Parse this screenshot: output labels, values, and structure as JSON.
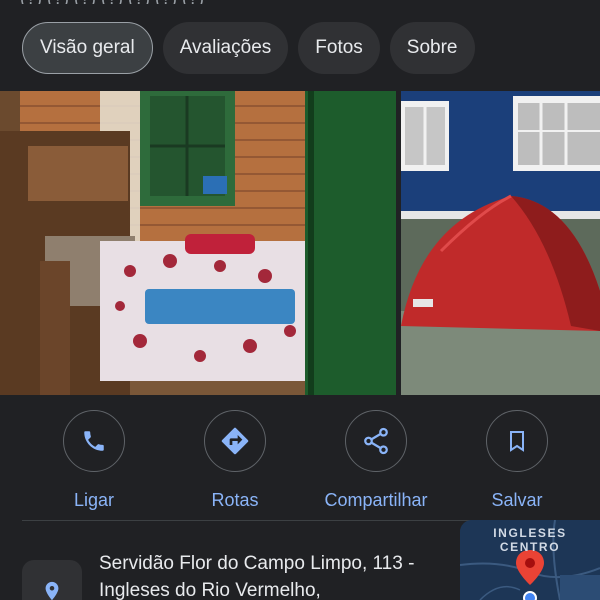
{
  "header": {
    "clipped_text": "(?) (?) (?) (?) (?) (?) (?)"
  },
  "tabs": [
    {
      "label": "Visão geral",
      "active": true
    },
    {
      "label": "Avaliações",
      "active": false
    },
    {
      "label": "Fotos",
      "active": false
    },
    {
      "label": "Sobre",
      "active": false
    }
  ],
  "photos": [
    {
      "icon": "bedroom-photo"
    },
    {
      "icon": "tent-photo"
    }
  ],
  "actions": [
    {
      "label": "Ligar",
      "icon": "phone-icon"
    },
    {
      "label": "Rotas",
      "icon": "directions-icon"
    },
    {
      "label": "Compartilhar",
      "icon": "share-icon"
    },
    {
      "label": "Salvar",
      "icon": "bookmark-icon"
    }
  ],
  "address": {
    "line1": "Servidão Flor do Campo Limpo, 113 -",
    "line2": "Ingleses do Rio Vermelho,",
    "icon": "location-pin-icon"
  },
  "map": {
    "label_line1": "INGLESES",
    "label_line2": "CENTRO"
  },
  "colors": {
    "background": "#202124",
    "accent": "#8ab4f8",
    "chip": "#303134"
  }
}
